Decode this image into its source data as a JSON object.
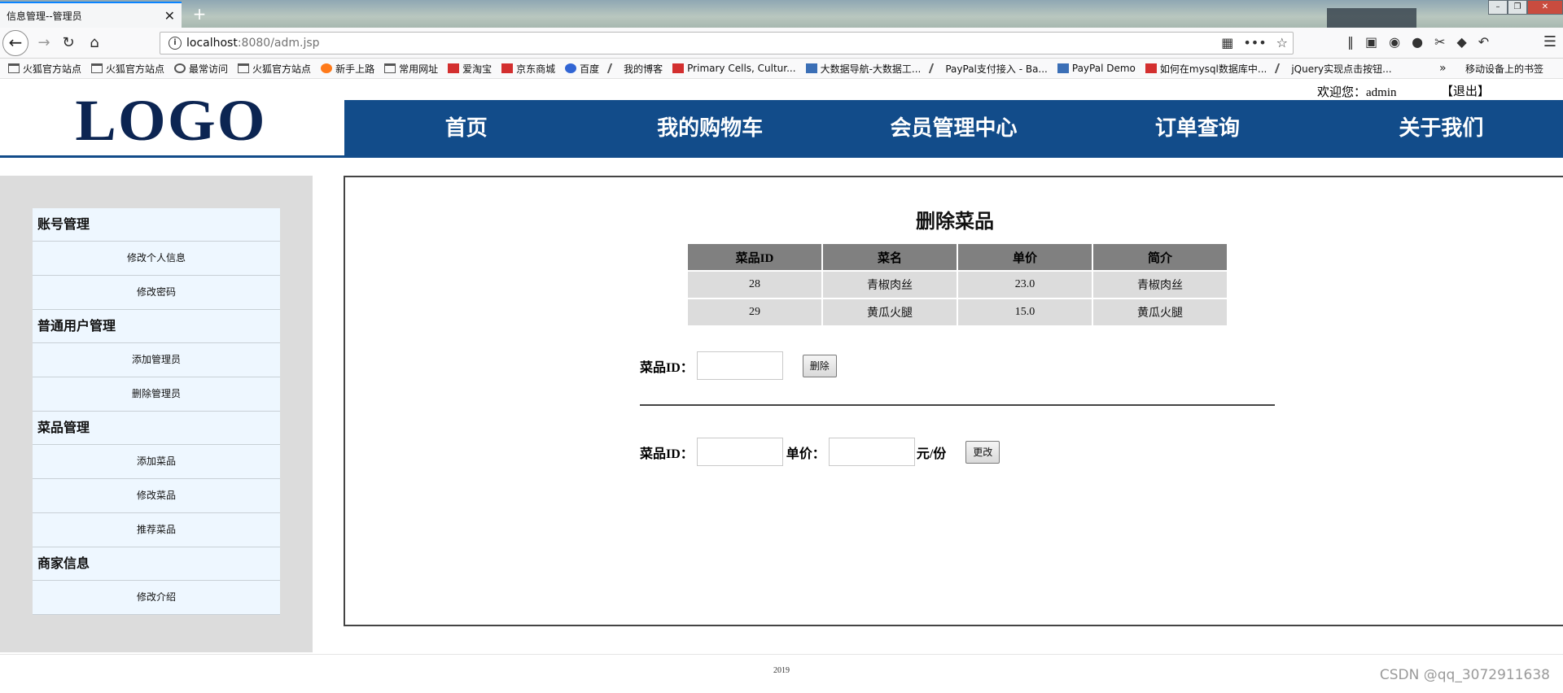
{
  "browser": {
    "tab_title": "信息管理--管理员",
    "url_host": "localhost",
    "url_rest": ":8080/adm.jsp",
    "bookmarks": [
      {
        "label": "火狐官方站点",
        "icon": "folder"
      },
      {
        "label": "火狐官方站点",
        "icon": "folder"
      },
      {
        "label": "最常访问",
        "icon": "gear"
      },
      {
        "label": "火狐官方站点",
        "icon": "folder"
      },
      {
        "label": "新手上路",
        "icon": "orange"
      },
      {
        "label": "常用网址",
        "icon": "folder"
      },
      {
        "label": "爱淘宝",
        "icon": "red"
      },
      {
        "label": "京东商城",
        "icon": "red"
      },
      {
        "label": "百度",
        "icon": "paw"
      },
      {
        "label": "我的博客",
        "icon": "line"
      },
      {
        "label": "Primary Cells, Cultur...",
        "icon": "red"
      },
      {
        "label": "大数据导航-大数据工...",
        "icon": "blue"
      },
      {
        "label": "PayPal支付接入 - Ba...",
        "icon": "line"
      },
      {
        "label": "PayPal Demo",
        "icon": "blue"
      },
      {
        "label": "如何在mysql数据库中...",
        "icon": "red"
      },
      {
        "label": "jQuery实现点击按钮...",
        "icon": "line"
      }
    ],
    "bookmarks_mobile": "移动设备上的书签"
  },
  "header": {
    "welcome": "欢迎您：admin",
    "logout": "【退出】",
    "logo": "LOGO",
    "nav": [
      "首页",
      "我的购物车",
      "会员管理中心",
      "订单查询",
      "关于我们"
    ]
  },
  "sidebar": {
    "groups": [
      {
        "title": "账号管理",
        "items": [
          "修改个人信息",
          "修改密码"
        ]
      },
      {
        "title": "普通用户管理",
        "items": [
          "添加管理员",
          "删除管理员"
        ]
      },
      {
        "title": "菜品管理",
        "items": [
          "添加菜品",
          "修改菜品",
          "推荐菜品"
        ]
      },
      {
        "title": "商家信息",
        "items": [
          "修改介绍"
        ]
      }
    ]
  },
  "main": {
    "title": "删除菜品",
    "table": {
      "headers": [
        "菜品ID",
        "菜名",
        "单价",
        "简介"
      ],
      "rows": [
        [
          "28",
          "青椒肉丝",
          "23.0",
          "青椒肉丝"
        ],
        [
          "29",
          "黄瓜火腿",
          "15.0",
          "黄瓜火腿"
        ]
      ]
    },
    "delete_form": {
      "id_label": "菜品ID：",
      "id_value": "",
      "button": "删除"
    },
    "update_form": {
      "id_label": "菜品ID：",
      "id_value": "",
      "price_label": "单价：",
      "price_value": "",
      "unit": "元/份",
      "button": "更改"
    }
  },
  "footer": {
    "year": "2019",
    "watermark": "CSDN @qq_3072911638"
  },
  "colors": {
    "nav_bg": "#124c8a",
    "logo": "#0c2552",
    "sidebar_bg": "#dcdcdc",
    "menu_bg": "#eef7ff"
  }
}
